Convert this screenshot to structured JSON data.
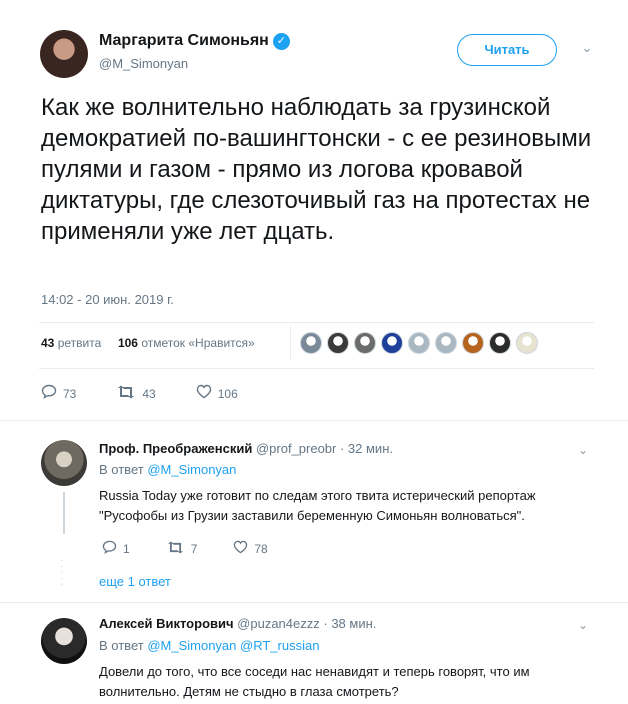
{
  "main_tweet": {
    "author_name": "Маргарита Симоньян",
    "verified_mark": "✓",
    "handle": "@M_Simonyan",
    "follow_label": "Читать",
    "text": "Как же волнительно наблюдать за грузинской демократией по-вашингтонски - с ее резиновыми пулями и газом - прямо из логова кровавой диктатуры, где слезоточивый газ на протестах не применяли уже лет дцать.",
    "timestamp": "14:02 - 20 июн. 2019 г.",
    "retweet_count": "43",
    "retweet_label": "ретвита",
    "like_count": "106",
    "like_label": "отметок «Нравится»",
    "actions": {
      "reply_count": "73",
      "retweet_count": "43",
      "like_count": "106"
    },
    "liker_colors": [
      "#7a8a99",
      "#3b3b3b",
      "#6b6b6b",
      "#1e3f9a",
      "#aab8c2",
      "#aab8c2",
      "#b5651d",
      "#2c2c2c",
      "#e8e2d0"
    ]
  },
  "replies": [
    {
      "author_name": "Проф. Преображенский",
      "handle": "@prof_preobr",
      "time": "· 32 мин.",
      "in_reply_prefix": "В ответ",
      "in_reply_to": "@M_Simonyan",
      "text": "Russia Today уже готовит по следам этого твита истерический репортаж \"Русофобы из Грузии заставили беременную Симоньян волноваться\".",
      "reply_count": "1",
      "retweet_count": "7",
      "like_count": "78",
      "show_more": "еще 1 ответ"
    },
    {
      "author_name": "Алексей Викторович",
      "handle": "@puzan4ezzz",
      "time": "· 38 мин.",
      "in_reply_prefix": "В ответ",
      "in_reply_to": "@M_Simonyan @RT_russian",
      "text": "Довели до того, что все соседи нас ненавидят и теперь говорят, что им волнительно. Детям не стыдно в глаза смотреть?"
    }
  ],
  "icons": {
    "reply": "reply-icon",
    "retweet": "retweet-icon",
    "like": "heart-icon",
    "caret": "chevron-down-icon"
  },
  "colors": {
    "accent": "#1da1f2",
    "muted": "#657786",
    "text": "#14171a",
    "divider": "#e6ecf0"
  }
}
